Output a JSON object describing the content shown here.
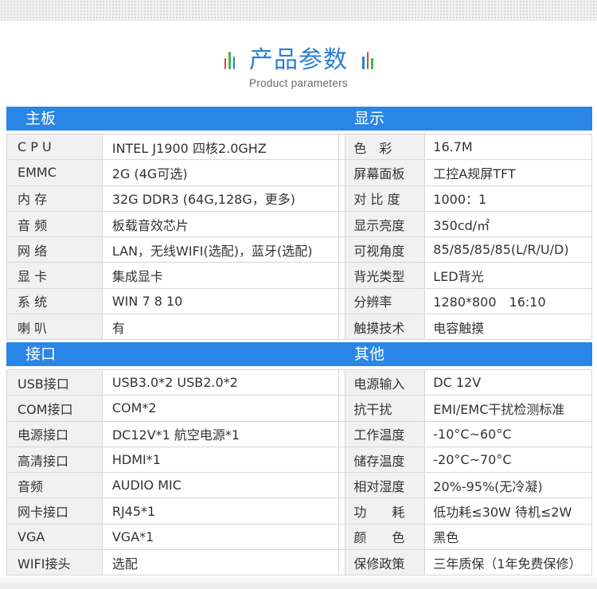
{
  "title": "产品参数",
  "subtitle": "Product parameters",
  "sections": {
    "mainboard": "主板",
    "display": "显示",
    "interface": "接口",
    "other": "其他"
  },
  "table1": [
    [
      "C P U",
      "INTEL J1900 四核2.0GHZ",
      "色　彩",
      "16.7M"
    ],
    [
      "EMMC",
      "2G (4G可选)",
      "屏幕面板",
      "工控A规屏TFT"
    ],
    [
      "内 存",
      "32G DDR3 (64G,128G，更多)",
      "对 比 度",
      "1000：1"
    ],
    [
      "音 频",
      "板载音效芯片",
      "显示亮度",
      "350cd/㎡"
    ],
    [
      "网 络",
      "LAN，无线WIFI(选配)，蓝牙(选配)",
      "可视角度",
      "85/85/85/85(L/R/U/D)"
    ],
    [
      "显 卡",
      "集成显卡",
      "背光类型",
      "LED背光"
    ],
    [
      "系 统",
      "WIN 7 8 10",
      "分辨率",
      "1280*800　16:10"
    ],
    [
      "喇 叭",
      "有",
      "触摸技术",
      "电容触摸"
    ]
  ],
  "table2": [
    [
      "USB接口",
      "USB3.0*2  USB2.0*2",
      "电源输入",
      "DC 12V"
    ],
    [
      "COM接口",
      "COM*2",
      "抗干扰",
      "EMI/EMC干扰检测标准"
    ],
    [
      "电源接口",
      "DC12V*1  航空电源*1",
      "工作温度",
      "-10°C~60°C"
    ],
    [
      "高清接口",
      "HDMI*1",
      "储存温度",
      "-20°C~70°C"
    ],
    [
      "音频",
      "AUDIO MIC",
      "相对湿度",
      "20%-95%(无冷凝)"
    ],
    [
      "网卡接口",
      "RJ45*1",
      "功　　耗",
      "低功耗≤30W 待机≤2W"
    ],
    [
      "VGA",
      "VGA*1",
      "颜　　色",
      "黑色"
    ],
    [
      "WIFI接头",
      "选配",
      "保修政策",
      "三年质保（1年免费保修）"
    ]
  ],
  "colors": {
    "accent": "#2a86e6",
    "title": "#2a7fd6",
    "label_bg": "#f1f1f1",
    "border": "#d7d7d7",
    "deco_red": "#e0463a",
    "deco_green": "#3cb84b",
    "deco_blue": "#2a7fd6"
  }
}
